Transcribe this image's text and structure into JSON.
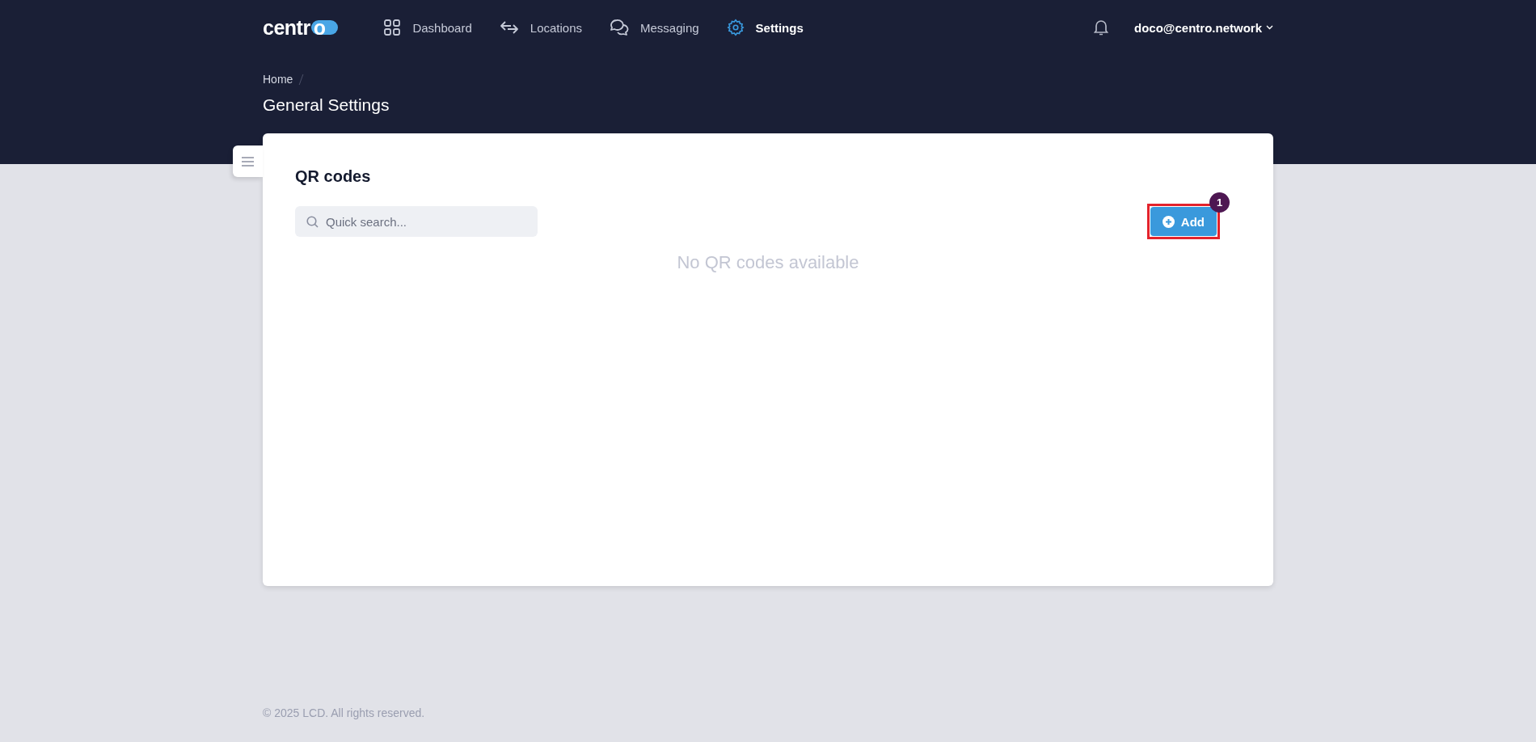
{
  "logo": {
    "text": "centr",
    "mark": "o"
  },
  "nav": [
    {
      "label": "Dashboard",
      "selected": false
    },
    {
      "label": "Locations",
      "selected": false
    },
    {
      "label": "Messaging",
      "selected": false
    },
    {
      "label": "Settings",
      "selected": true
    }
  ],
  "user": {
    "email": "doco@centro.network"
  },
  "breadcrumb": [
    "Home"
  ],
  "page_title": "General Settings",
  "card": {
    "title": "QR codes",
    "search": {
      "placeholder": "Quick search..."
    },
    "add_button": {
      "label": "Add",
      "highlighted": true,
      "step": "1"
    },
    "empty_message": "No QR codes available"
  },
  "footer": "© 2025 LCD. All rights reserved."
}
